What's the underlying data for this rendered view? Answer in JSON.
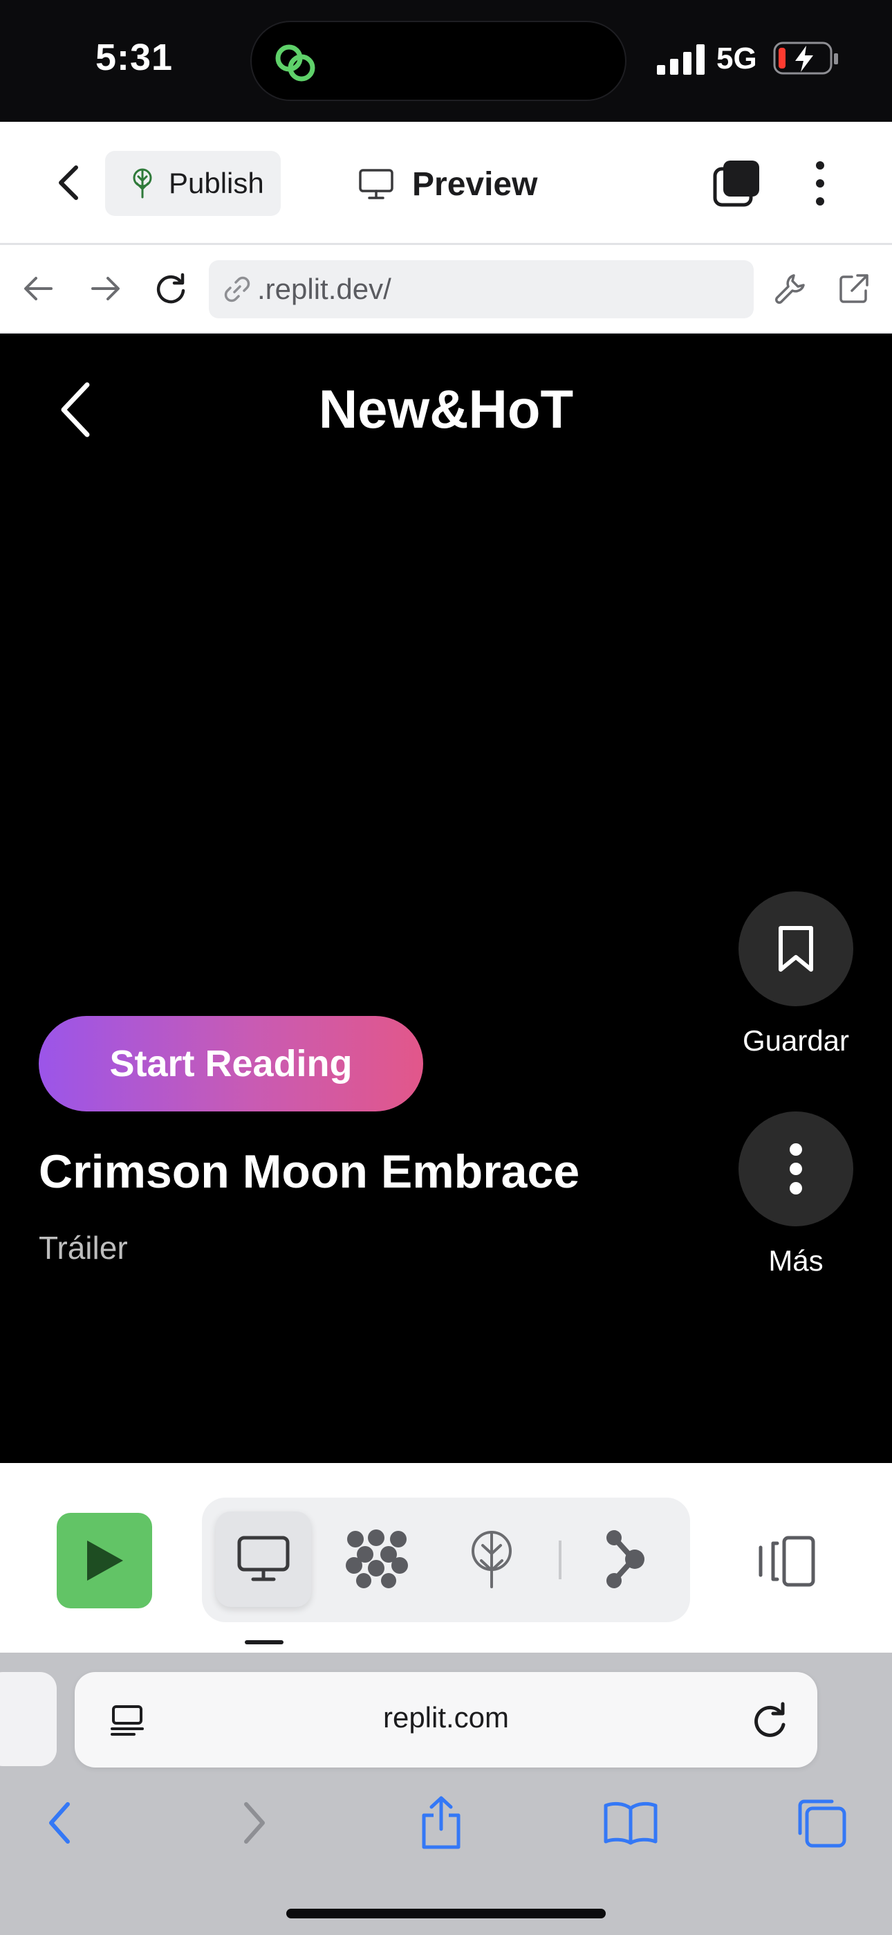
{
  "status_bar": {
    "time": "5:31",
    "network": "5G",
    "battery_state": "low-charging"
  },
  "replit_top_bar": {
    "publish_label": "Publish",
    "preview_label": "Preview"
  },
  "url_bar": {
    "url": ".replit.dev/"
  },
  "app": {
    "header_title": "New&HoT",
    "save_label": "Guardar",
    "more_label": "Más",
    "cta_label": "Start Reading",
    "series_title": "Crimson Moon Embrace",
    "series_subtitle": "Tráiler",
    "cta_gradient": [
      "#9b55e9",
      "#e2578a"
    ]
  },
  "tool_bar": {
    "run_color": "#62c466",
    "tools": [
      "preview-icon",
      "agent-icon",
      "deploy-icon",
      "git-icon"
    ],
    "active_tool": "preview-icon"
  },
  "safari": {
    "address": "replit.com",
    "accent": "#3478f6"
  }
}
